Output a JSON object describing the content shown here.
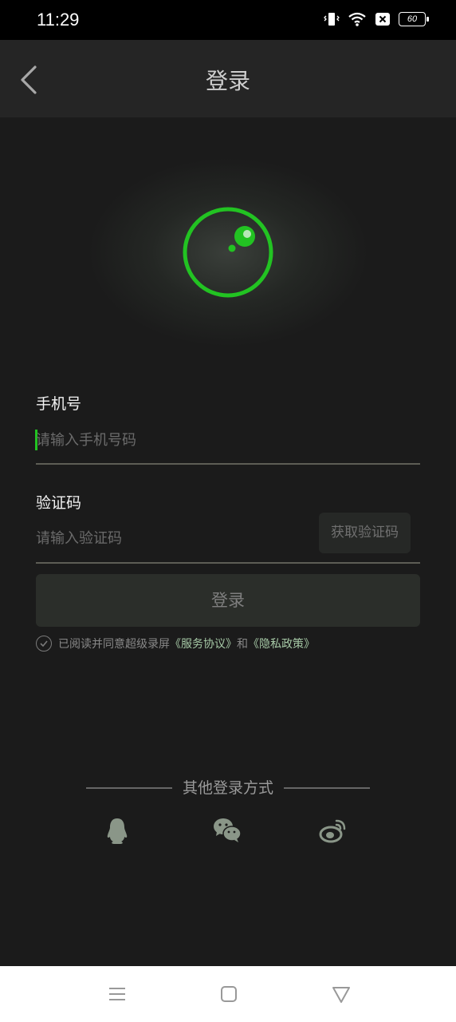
{
  "status": {
    "time": "11:29",
    "battery": "60"
  },
  "header": {
    "title": "登录"
  },
  "phone": {
    "label": "手机号",
    "placeholder": "请输入手机号码"
  },
  "code": {
    "label": "验证码",
    "placeholder": "请输入验证码",
    "get_code": "获取验证码"
  },
  "login_button": "登录",
  "agreement": {
    "prefix": "已阅读并同意超级录屏",
    "service": "《服务协议》",
    "and": "和",
    "privacy": "《隐私政策》"
  },
  "other_login": {
    "title": "其他登录方式",
    "methods": [
      "qq-icon",
      "wechat-icon",
      "weibo-icon"
    ]
  },
  "colors": {
    "accent": "#22c322",
    "background": "#1b1b1b",
    "link": "#a6c9a6"
  }
}
